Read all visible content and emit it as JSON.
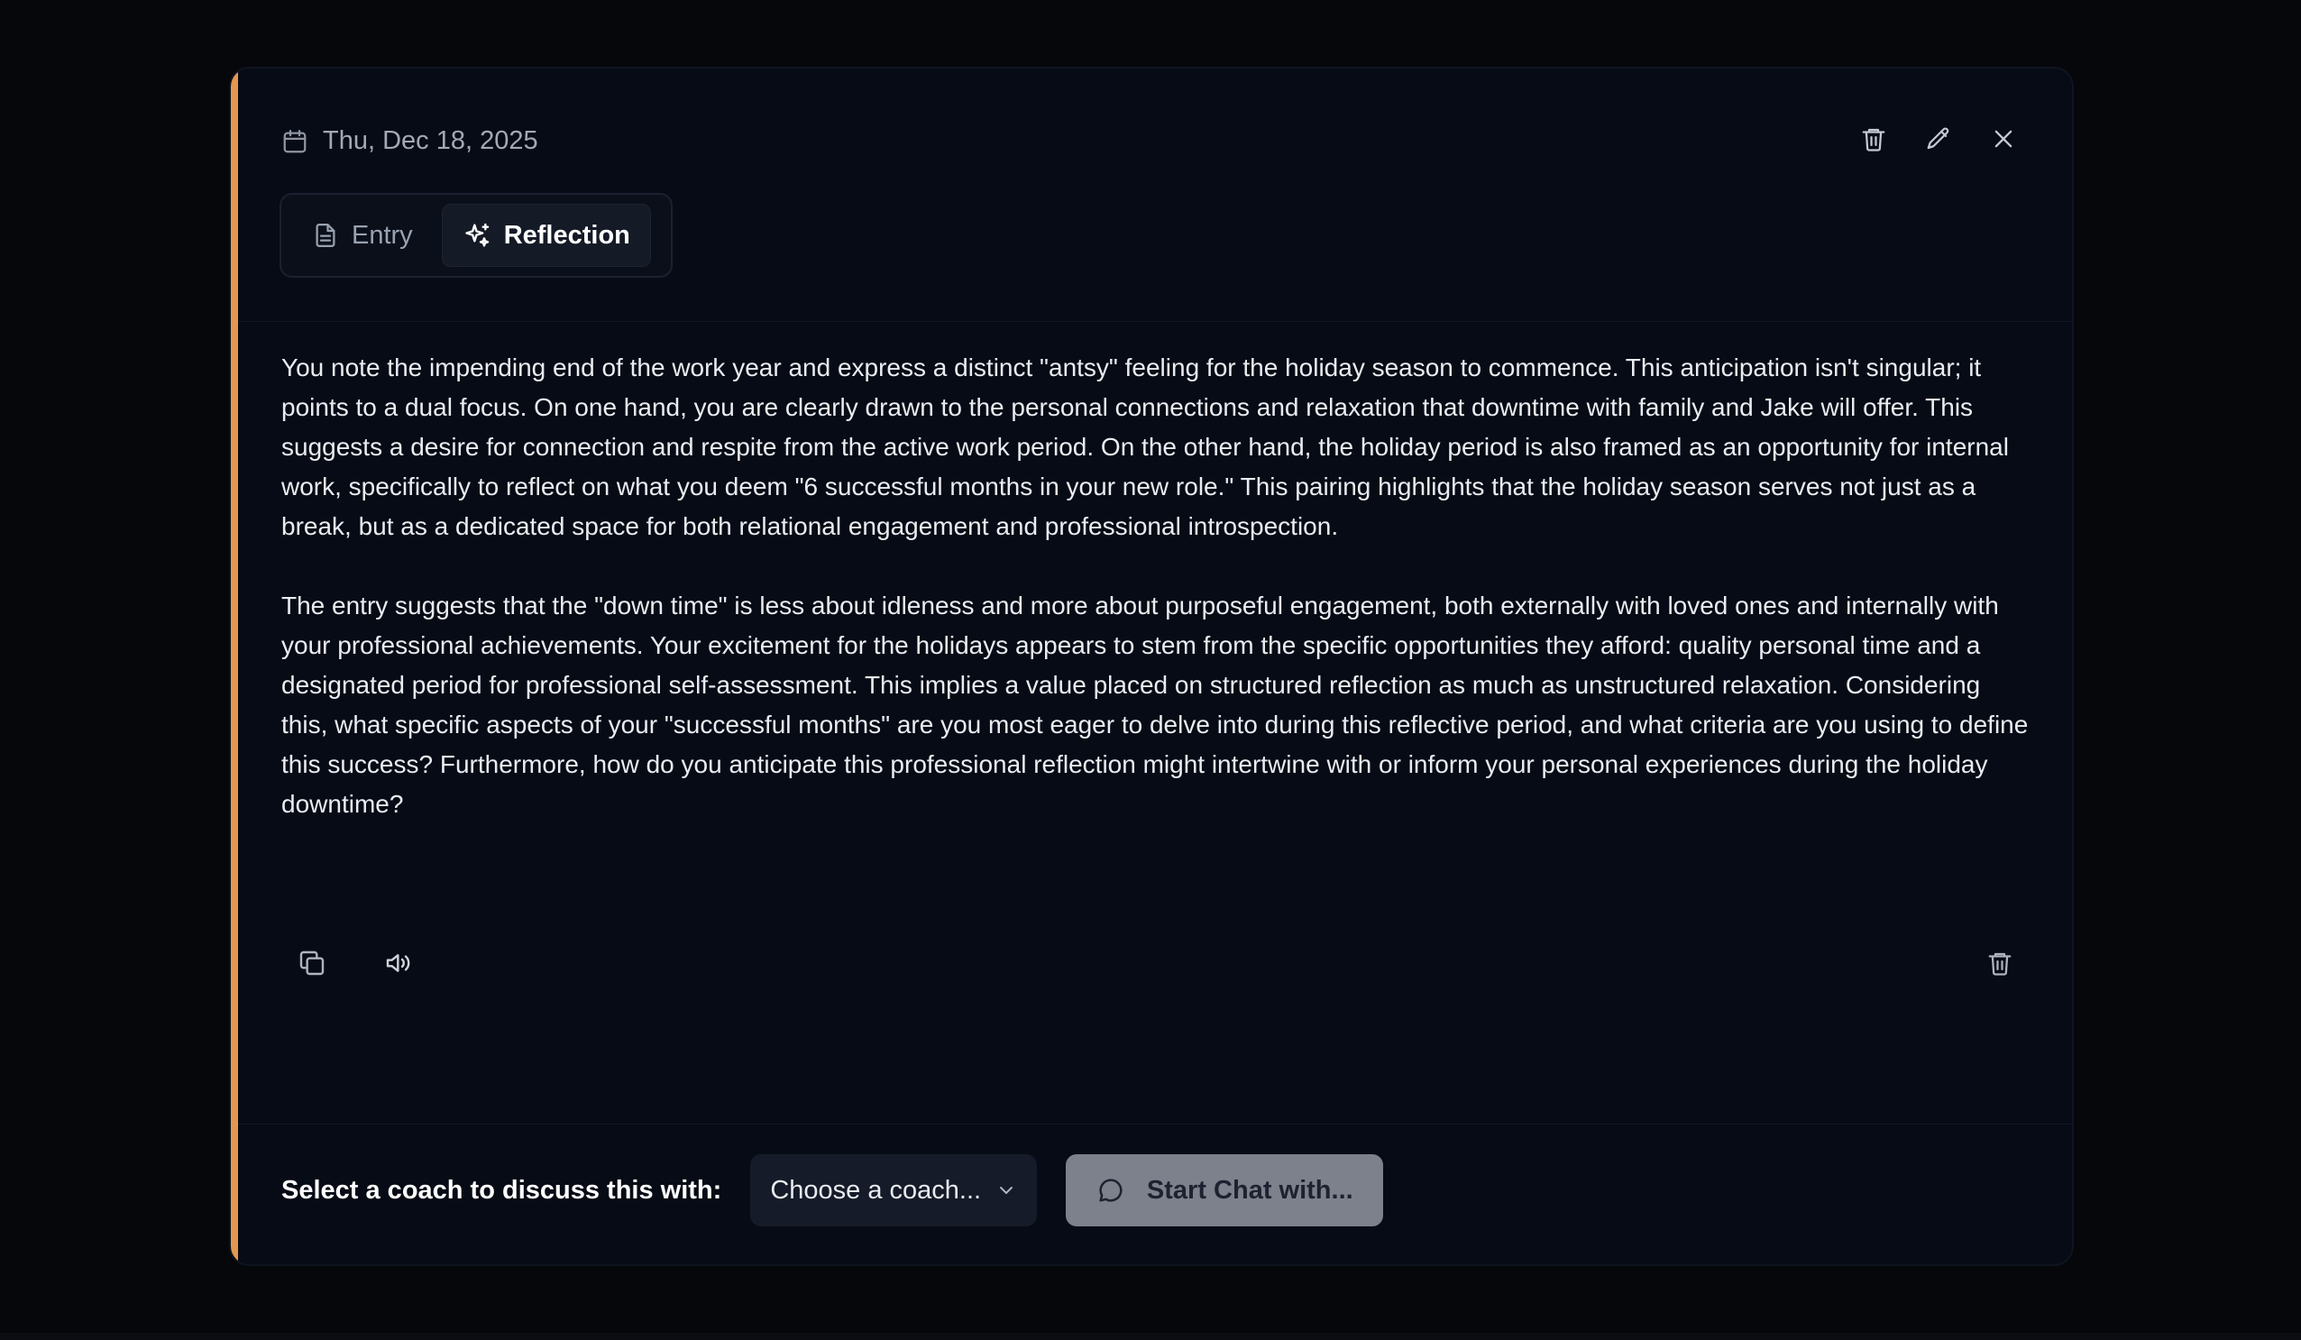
{
  "modal": {
    "date": "Thu, Dec 18, 2025",
    "tabs": [
      {
        "label": "Entry",
        "active": false
      },
      {
        "label": "Reflection",
        "active": true
      }
    ],
    "accent_color": "#e3974f",
    "reflection": {
      "paragraphs": [
        "You note the impending end of the work year and express a distinct \"antsy\" feeling for the holiday season to commence. This anticipation isn't singular; it points to a dual focus. On one hand, you are clearly drawn to the personal connections and relaxation that downtime with family and Jake will offer. This suggests a desire for connection and respite from the active work period. On the other hand, the holiday period is also framed as an opportunity for internal work, specifically to reflect on what you deem \"6 successful months in your new role.\" This pairing highlights that the holiday season serves not just as a break, but as a dedicated space for both relational engagement and professional introspection.",
        "The entry suggests that the \"down time\" is less about idleness and more about purposeful engagement, both externally with loved ones and internally with your professional achievements. Your excitement for the holidays appears to stem from the specific opportunities they afford: quality personal time and a designated period for professional self-assessment. This implies a value placed on structured reflection as much as unstructured relaxation. Considering this, what specific aspects of your \"successful months\" are you most eager to delve into during this reflective period, and what criteria are you using to define this success? Furthermore, how do you anticipate this professional reflection might intertwine with or inform your personal experiences during the holiday downtime?"
      ]
    },
    "footer": {
      "label": "Select a coach to discuss this with:",
      "select_value": "Choose a coach...",
      "start_button": "Start Chat with..."
    }
  },
  "icons": {
    "calendar": "calendar-icon",
    "trash": "trash-icon",
    "edit": "pencil-icon",
    "close": "close-icon",
    "entry": "document-icon",
    "reflection": "sparkles-icon",
    "copy": "copy-icon",
    "speaker": "speaker-icon",
    "chevron": "chevron-down-icon",
    "chat": "chat-bubble-icon"
  }
}
